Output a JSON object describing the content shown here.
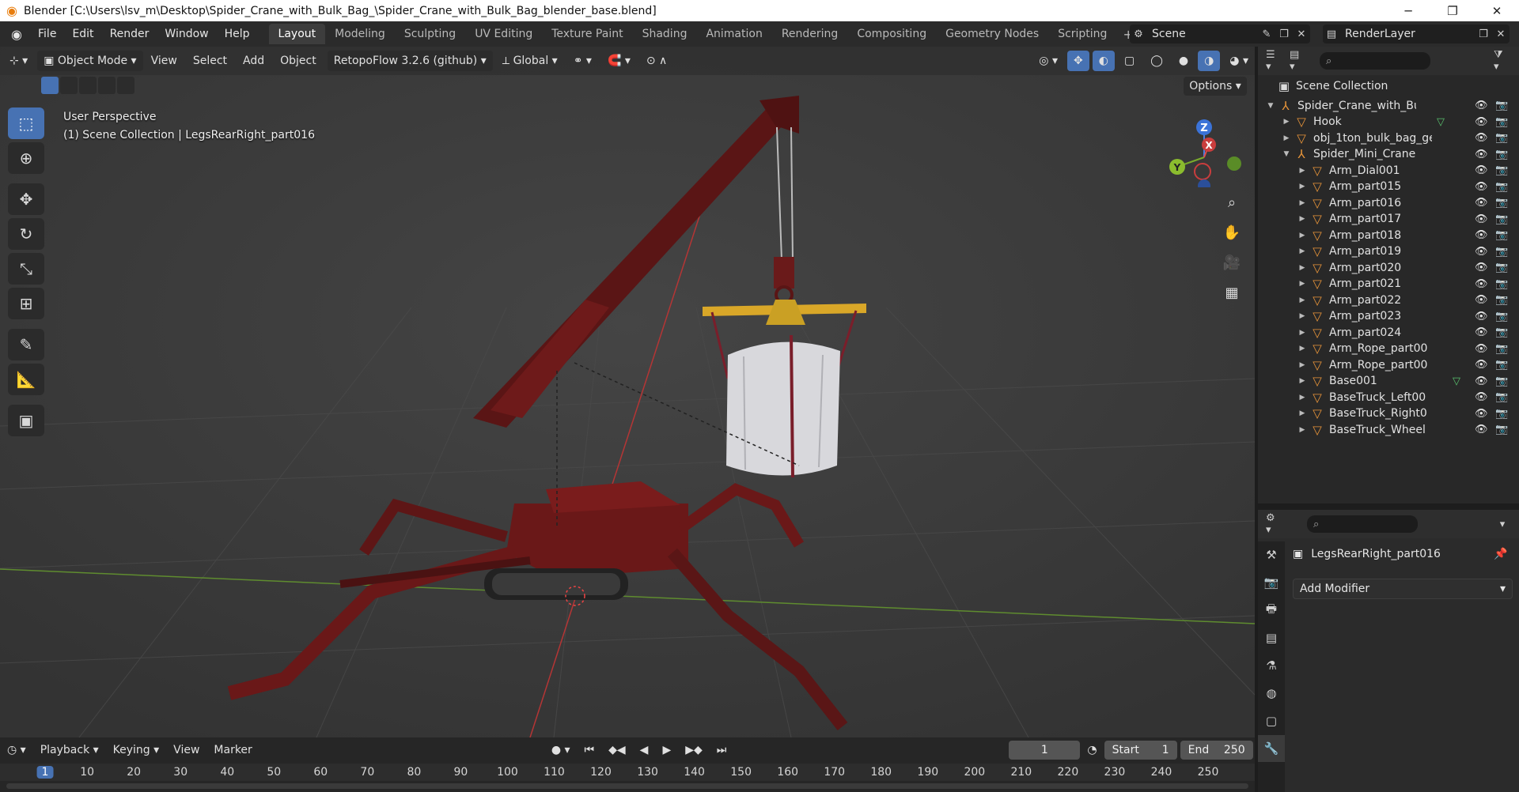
{
  "window": {
    "title": "Blender [C:\\Users\\lsv_m\\Desktop\\Spider_Crane_with_Bulk_Bag_\\Spider_Crane_with_Bulk_Bag_blender_base.blend]",
    "minimize": "─",
    "maximize": "❐",
    "close": "✕"
  },
  "menu": [
    "File",
    "Edit",
    "Render",
    "Window",
    "Help"
  ],
  "workspaces": {
    "tabs": [
      "Layout",
      "Modeling",
      "Sculpting",
      "UV Editing",
      "Texture Paint",
      "Shading",
      "Animation",
      "Rendering",
      "Compositing",
      "Geometry Nodes",
      "Scripting"
    ],
    "active": "Layout",
    "add": "+"
  },
  "scene": {
    "name": "Scene"
  },
  "render_layer": {
    "name": "RenderLayer"
  },
  "viewport": {
    "mode": "Object Mode",
    "menus": [
      "View",
      "Select",
      "Add",
      "Object"
    ],
    "addon": "RetopoFlow 3.2.6 (github)",
    "orientation": "Global",
    "options": "Options",
    "info_line1": "User Perspective",
    "info_line2": "(1) Scene Collection | LegsRearRight_part016",
    "axes": {
      "x": "X",
      "y": "Y",
      "z": "Z"
    },
    "colors": {
      "bg": "#393939",
      "crane": "#6e1a1a",
      "select": "#4772b3"
    }
  },
  "timeline": {
    "menus": [
      "Playback",
      "Keying",
      "View",
      "Marker"
    ],
    "current_frame": "1",
    "start_label": "Start",
    "start": "1",
    "end_label": "End",
    "end": "250",
    "ruler": [
      "1",
      "10",
      "20",
      "30",
      "40",
      "50",
      "60",
      "70",
      "80",
      "90",
      "100",
      "110",
      "120",
      "130",
      "140",
      "150",
      "160",
      "170",
      "180",
      "190",
      "200",
      "210",
      "220",
      "230",
      "240",
      "250"
    ]
  },
  "outliner": {
    "root": "Scene Collection",
    "items": [
      {
        "label": "Spider_Crane_with_Bulk_B",
        "icon": "empty-icon",
        "depth": 1,
        "expanded": true
      },
      {
        "label": "Hook",
        "icon": "mesh-icon",
        "depth": 2,
        "data": true
      },
      {
        "label": "obj_1ton_bulk_bag_ge",
        "icon": "mesh-icon",
        "depth": 2
      },
      {
        "label": "Spider_Mini_Crane",
        "icon": "empty-icon",
        "depth": 2,
        "expanded": true
      },
      {
        "label": "Arm_Dial001",
        "icon": "mesh-icon",
        "depth": 3
      },
      {
        "label": "Arm_part015",
        "icon": "mesh-icon",
        "depth": 3
      },
      {
        "label": "Arm_part016",
        "icon": "mesh-icon",
        "depth": 3
      },
      {
        "label": "Arm_part017",
        "icon": "mesh-icon",
        "depth": 3
      },
      {
        "label": "Arm_part018",
        "icon": "mesh-icon",
        "depth": 3
      },
      {
        "label": "Arm_part019",
        "icon": "mesh-icon",
        "depth": 3
      },
      {
        "label": "Arm_part020",
        "icon": "mesh-icon",
        "depth": 3
      },
      {
        "label": "Arm_part021",
        "icon": "mesh-icon",
        "depth": 3
      },
      {
        "label": "Arm_part022",
        "icon": "mesh-icon",
        "depth": 3
      },
      {
        "label": "Arm_part023",
        "icon": "mesh-icon",
        "depth": 3
      },
      {
        "label": "Arm_part024",
        "icon": "mesh-icon",
        "depth": 3
      },
      {
        "label": "Arm_Rope_part00",
        "icon": "mesh-icon",
        "depth": 3
      },
      {
        "label": "Arm_Rope_part00",
        "icon": "mesh-icon",
        "depth": 3
      },
      {
        "label": "Base001",
        "icon": "mesh-icon",
        "depth": 3,
        "data": true
      },
      {
        "label": "BaseTruck_Left00",
        "icon": "mesh-icon",
        "depth": 3
      },
      {
        "label": "BaseTruck_Right0",
        "icon": "mesh-icon",
        "depth": 3
      },
      {
        "label": "BaseTruck_Wheel",
        "icon": "mesh-icon",
        "depth": 3
      }
    ]
  },
  "properties": {
    "object_name": "LegsRearRight_part016",
    "add_modifier": "Add Modifier"
  }
}
